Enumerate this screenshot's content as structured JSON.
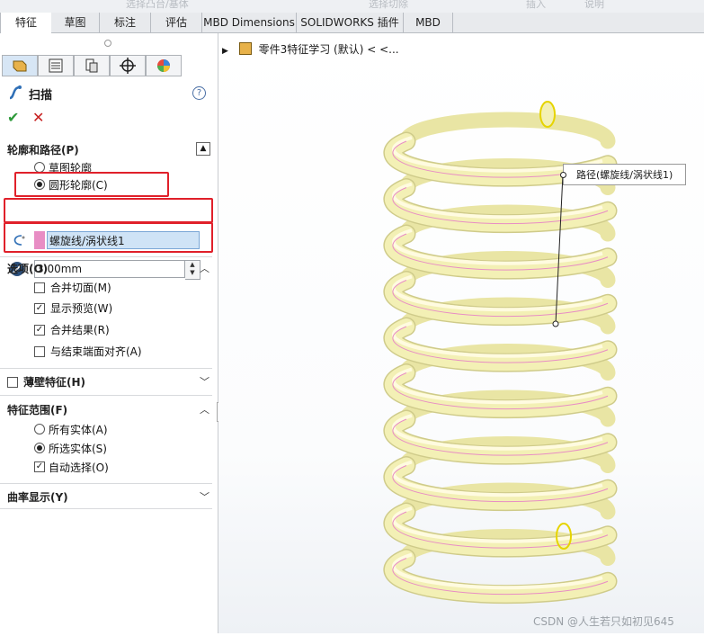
{
  "top_strip": [
    "选择凸台/基体",
    "选择切除",
    "插入",
    "说明"
  ],
  "tabs": [
    "特征",
    "草图",
    "标注",
    "评估",
    "MBD Dimensions",
    "SOLIDWORKS 插件",
    "MBD"
  ],
  "feature": {
    "title": "扫描",
    "help": "?",
    "ok": "✔",
    "cancel": "✕"
  },
  "profile_section": {
    "title": "轮廓和路径(P)",
    "options": [
      {
        "label": "草图轮廓",
        "selected": false
      },
      {
        "label": "圆形轮廓(C)",
        "selected": true
      }
    ],
    "path_value": "螺旋线/涡状线1",
    "diameter_value": "3.00mm"
  },
  "options_section": {
    "title": "选项(O)",
    "items": [
      {
        "label": "合并切面(M)",
        "checked": false
      },
      {
        "label": "显示预览(W)",
        "checked": true
      },
      {
        "label": "合并结果(R)",
        "checked": true
      },
      {
        "label": "与结束端面对齐(A)",
        "checked": false
      }
    ]
  },
  "thin_section": {
    "title": "薄壁特征(H)",
    "checked": false
  },
  "scope_section": {
    "title": "特征范围(F)",
    "options": [
      {
        "label": "所有实体(A)",
        "selected": false
      },
      {
        "label": "所选实体(S)",
        "selected": true
      }
    ],
    "auto_select": {
      "label": "自动选择(O)",
      "checked": true
    }
  },
  "curvature_section": {
    "title": "曲率显示(Y)"
  },
  "tree": {
    "label": "零件3特征学习 (默认) < <..."
  },
  "callout": {
    "label": "路径(螺旋线/涡状线1)"
  },
  "watermark": "CSDN @人生若只如初见645",
  "colors": {
    "highlight_red": "#e0202a",
    "spring": "#f3f0b5",
    "path_pink": "#e88dc4"
  }
}
